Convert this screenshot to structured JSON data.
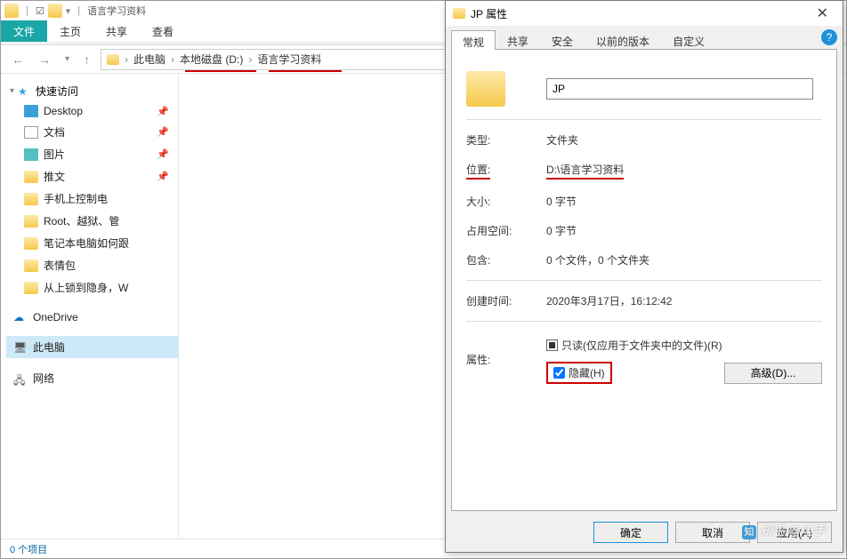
{
  "explorer": {
    "qat": {
      "check": "☑",
      "folder": ""
    },
    "title": "语言学习资料",
    "ribbon": {
      "file": "文件",
      "home": "主页",
      "share": "共享",
      "view": "查看"
    },
    "breadcrumb": {
      "this_pc": "此电脑",
      "drive": "本地磁盘 (D:)",
      "folder": "语言学习资料"
    },
    "sidebar": {
      "quick": {
        "label": "快速访问",
        "items": [
          {
            "label": "Desktop",
            "pin": true,
            "icon": "desktop"
          },
          {
            "label": "文档",
            "pin": true,
            "icon": "doc"
          },
          {
            "label": "图片",
            "pin": true,
            "icon": "pic"
          },
          {
            "label": "推文",
            "pin": true,
            "icon": "folder"
          },
          {
            "label": "手机上控制电",
            "pin": false,
            "icon": "folder"
          },
          {
            "label": "Root、越狱、管",
            "pin": false,
            "icon": "folder"
          },
          {
            "label": "笔记本电脑如何跟",
            "pin": false,
            "icon": "folder"
          },
          {
            "label": "表情包",
            "pin": false,
            "icon": "folder"
          },
          {
            "label": "从上锁到隐身，W",
            "pin": false,
            "icon": "folder"
          }
        ]
      },
      "onedrive": "OneDrive",
      "this_pc": "此电脑",
      "network": "网络"
    },
    "status": "0 个项目"
  },
  "dialog": {
    "title": "JP 属性",
    "tabs": {
      "general": "常规",
      "share": "共享",
      "security": "安全",
      "prev": "以前的版本",
      "custom": "自定义"
    },
    "name_value": "JP",
    "type": {
      "k": "类型:",
      "v": "文件夹"
    },
    "location": {
      "k": "位置:",
      "v": "D:\\语言学习资料"
    },
    "size": {
      "k": "大小:",
      "v": "0 字节"
    },
    "sizedisk": {
      "k": "占用空间:",
      "v": "0 字节"
    },
    "contains": {
      "k": "包含:",
      "v": "0 个文件，0 个文件夹"
    },
    "created": {
      "k": "创建时间:",
      "v": "2020年3月17日，16:12:42"
    },
    "attrs": {
      "k": "属性:",
      "readonly": "只读(仅应用于文件夹中的文件)(R)",
      "hidden": "隐藏(H)",
      "advanced": "高级(D)..."
    },
    "buttons": {
      "ok": "确定",
      "cancel": "取消",
      "apply": "应用(A)"
    }
  },
  "watermark": "知乎 @电手"
}
